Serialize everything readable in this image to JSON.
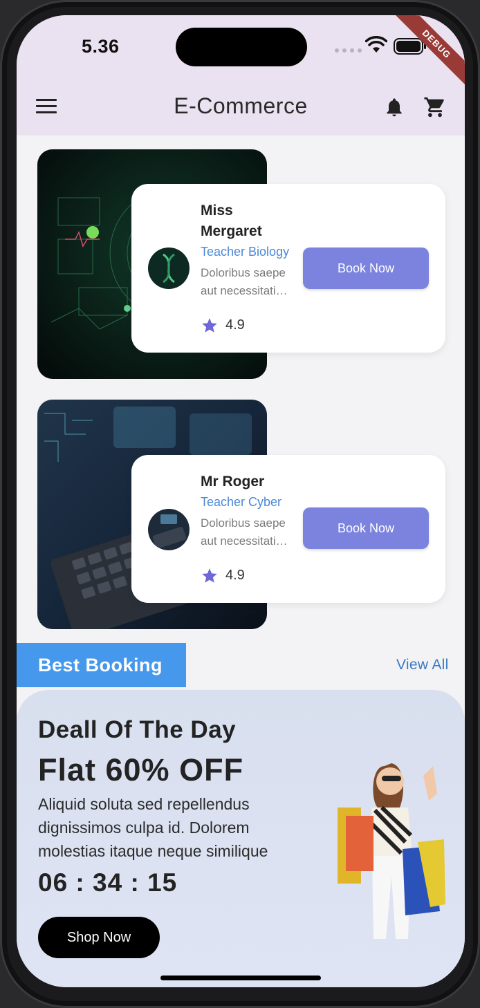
{
  "status_bar": {
    "time": "5.36",
    "debug_label": "DEBUG"
  },
  "app_bar": {
    "title": "E-Commerce",
    "icons": [
      "menu-icon",
      "bell-icon",
      "cart-icon"
    ]
  },
  "teachers": [
    {
      "name": "Miss Mergaret",
      "role": "Teacher Biology",
      "desc_line1": "Doloribus saepe",
      "desc_line2": "aut necessitati…",
      "rating": "4.9",
      "button": "Book Now"
    },
    {
      "name": "Mr Roger",
      "role": "Teacher Cyber",
      "desc_line1": "Doloribus saepe",
      "desc_line2": "aut necessitati…",
      "rating": "4.9",
      "button": "Book Now"
    }
  ],
  "best_booking": {
    "title": "Best Booking",
    "view_all": "View All"
  },
  "deal": {
    "title": "Deall Of The Day",
    "offer": "Flat 60% OFF",
    "desc_line1": "Aliquid soluta sed repellendus",
    "desc_line2": "dignissimos culpa id. Dolorem",
    "desc_line3": "molestias itaque neque similique",
    "timer": "06 : 34 : 15",
    "button": "Shop Now"
  },
  "colors": {
    "app_bar": "#ebe2f1",
    "accent_button": "#7b83df",
    "role_text": "#4a88d8",
    "best_booking_tag": "#4598ec",
    "star": "#6f66d8"
  }
}
